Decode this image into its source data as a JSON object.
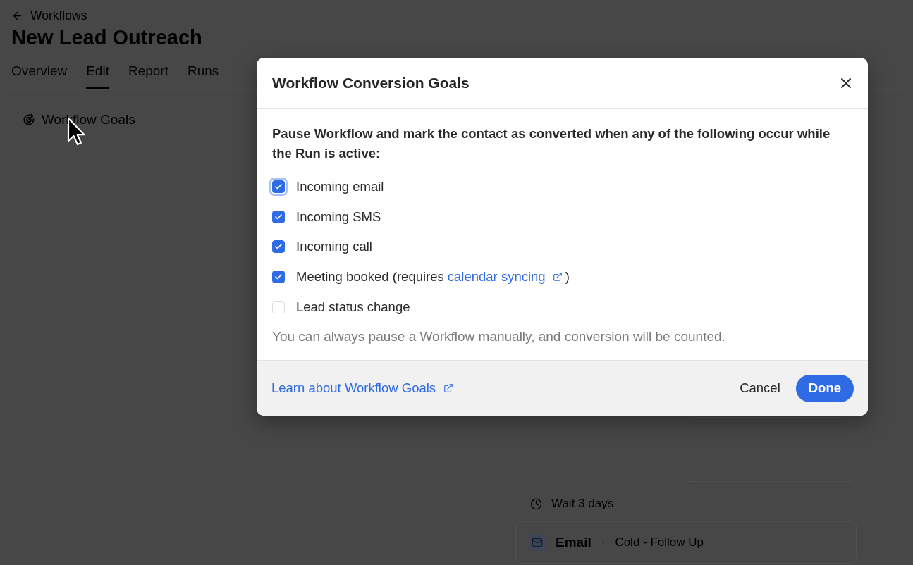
{
  "page": {
    "back_link": "Workflows",
    "title": "New Lead Outreach",
    "tabs": [
      {
        "label": "Overview",
        "selected": false
      },
      {
        "label": "Edit",
        "selected": true
      },
      {
        "label": "Report",
        "selected": false
      },
      {
        "label": "Runs",
        "selected": false
      }
    ],
    "goals_button": "Workflow Goals",
    "canvas": {
      "wait_step": "Wait 3 days",
      "email_step": {
        "type": "Email",
        "separator": "·",
        "template": "Cold - Follow Up"
      }
    }
  },
  "dialog": {
    "title": "Workflow Conversion Goals",
    "intro": "Pause Workflow and mark the contact as converted when any of the following occur while the Run is active:",
    "options": [
      {
        "kind": "text",
        "label": "Incoming email",
        "checked": true,
        "focused": true
      },
      {
        "kind": "text",
        "label": "Incoming SMS",
        "checked": true,
        "focused": false
      },
      {
        "kind": "text",
        "label": "Incoming call",
        "checked": true,
        "focused": false
      },
      {
        "kind": "link",
        "label": "Meeting booked (requires",
        "link": "calendar syncing",
        "after": ")",
        "checked": true,
        "focused": false
      },
      {
        "kind": "text",
        "label": "Lead status change",
        "checked": false,
        "focused": false
      }
    ],
    "hint": "You can always pause a Workflow manually, and conversion will be counted.",
    "learn_link": "Learn about Workflow Goals",
    "buttons": [
      {
        "kind": "secondary",
        "label": "Cancel"
      },
      {
        "kind": "primary",
        "label": "Done"
      }
    ]
  }
}
